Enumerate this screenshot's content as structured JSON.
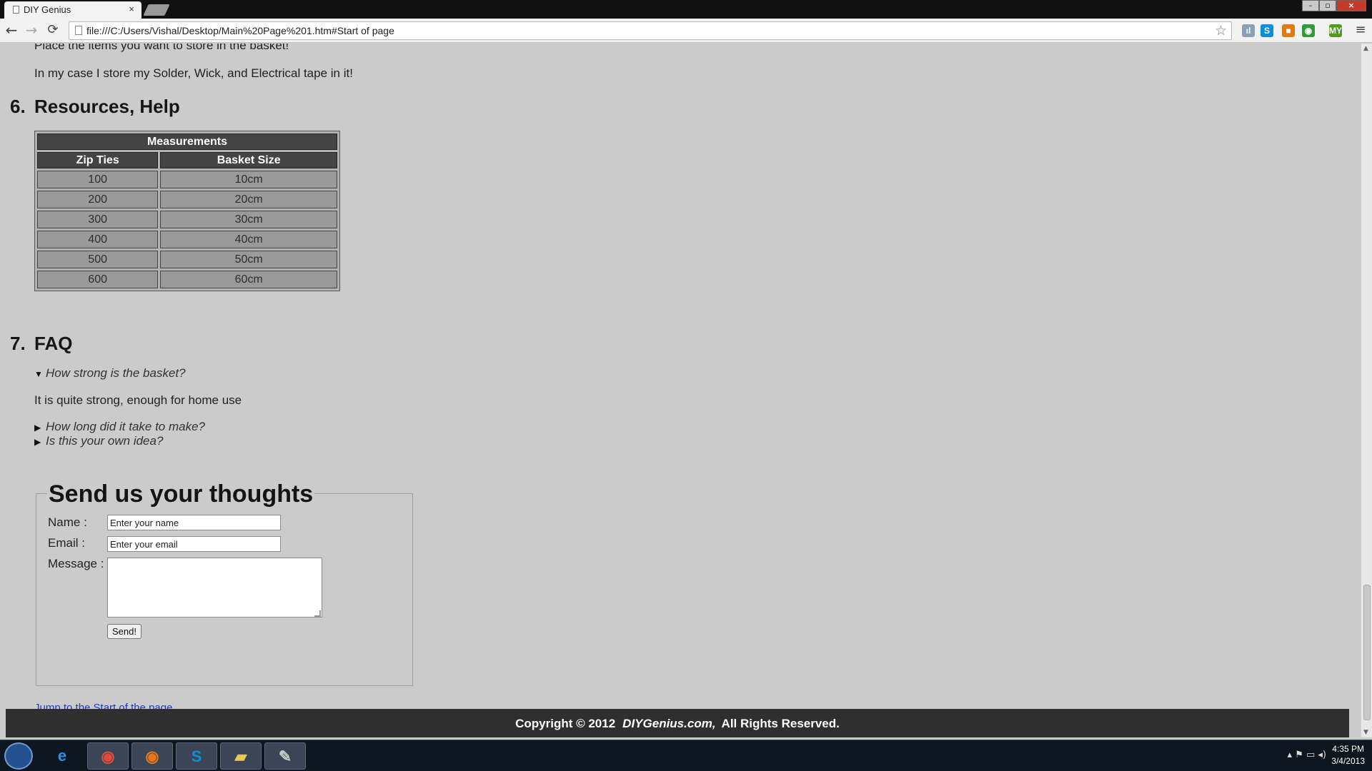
{
  "browser": {
    "tab_title": "DIY Genius",
    "tab_close": "×",
    "url": "file:///C:/Users/Vishal/Desktop/Main%20Page%201.htm#Start of page",
    "back": "←",
    "forward": "→",
    "reload": "⟳",
    "star": "☆",
    "menu": "≡",
    "window_controls": {
      "minimize": "–",
      "maximize": "▫",
      "close": "×"
    },
    "extensions": [
      {
        "name": "stats-extension-icon",
        "glyph": "ıl",
        "color": "#8aa0b6"
      },
      {
        "name": "skype-extension-icon",
        "glyph": "S",
        "color": "#0a8fd8"
      },
      {
        "name": "puzzle-extension-icon",
        "glyph": "■",
        "color": "#e07b12"
      },
      {
        "name": "green-extension-icon",
        "glyph": "◉",
        "color": "#2f9a3a"
      },
      {
        "name": "my-extension-icon",
        "glyph": "MY",
        "color": "#4f9d1f"
      }
    ]
  },
  "content": {
    "intro_line1": "Place the items you want to store in the basket!",
    "intro_line2": "In my case I store my Solder, Wick, and Electrical tape in it!",
    "section6": {
      "number": "6.",
      "title": "Resources, Help"
    },
    "table": {
      "caption": "Measurements",
      "headers": [
        "Zip Ties",
        "Basket Size"
      ],
      "rows": [
        [
          "100",
          "10cm"
        ],
        [
          "200",
          "20cm"
        ],
        [
          "300",
          "30cm"
        ],
        [
          "400",
          "40cm"
        ],
        [
          "500",
          "50cm"
        ],
        [
          "600",
          "60cm"
        ]
      ]
    },
    "section7": {
      "number": "7.",
      "title": "FAQ"
    },
    "faq": [
      {
        "question": "How strong is the basket?",
        "marker": "▼",
        "answer": "It is quite strong, enough for home use"
      },
      {
        "question": "How long did it take to make?",
        "marker": "▶"
      },
      {
        "question": "Is this your own idea?",
        "marker": "▶"
      }
    ],
    "form": {
      "title": "Send us your thoughts",
      "name_label": "Name :",
      "name_value": "Enter your name",
      "email_label": "Email :",
      "email_value": "Enter your email",
      "message_label": "Message :",
      "send_label": "Send!"
    },
    "partial_link": "Jump to the Start of the page"
  },
  "footer": {
    "copyright": "Copyright © 2012",
    "brand": "DIYGenius.com,",
    "rights": "All Rights Reserved."
  },
  "taskbar": {
    "apps": [
      {
        "name": "taskbar-ie-icon",
        "glyph": "e",
        "color": "#2f8fe6",
        "open": false
      },
      {
        "name": "taskbar-chrome-icon",
        "glyph": "◉",
        "color": "#e14b3b",
        "open": true
      },
      {
        "name": "taskbar-firefox-icon",
        "glyph": "◉",
        "color": "#e8741c",
        "open": true
      },
      {
        "name": "taskbar-skype-icon",
        "glyph": "S",
        "color": "#0a8fd8",
        "open": true
      },
      {
        "name": "taskbar-explorer-icon",
        "glyph": "▰",
        "color": "#e8c65a",
        "open": true
      },
      {
        "name": "taskbar-paint-icon",
        "glyph": "✎",
        "color": "#c9c9c9",
        "open": true
      }
    ],
    "tray_icons": "▴  ⚑  ▭  ◂)",
    "time": "4:35 PM",
    "date": "3/4/2013"
  }
}
